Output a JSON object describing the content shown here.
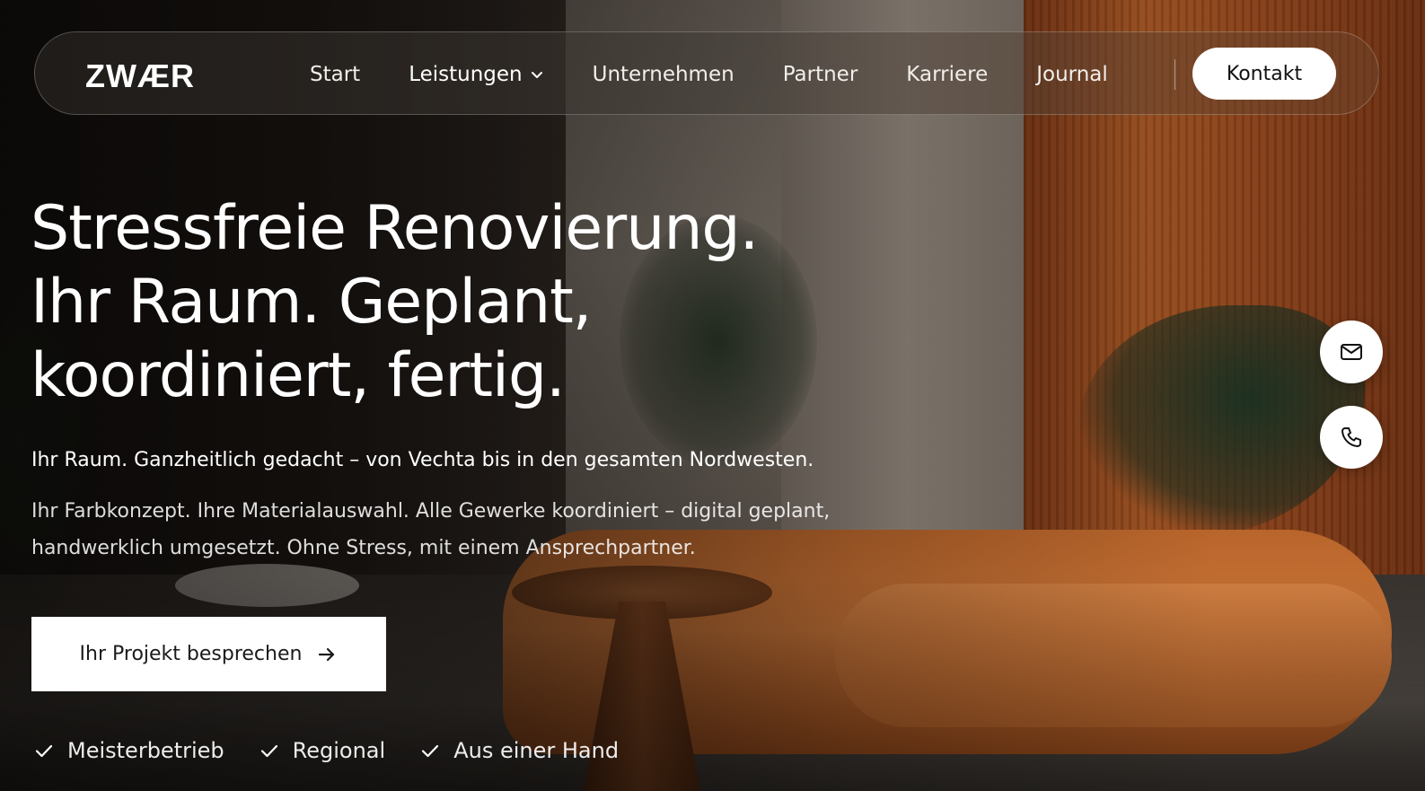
{
  "header": {
    "logo": "ZWÆR",
    "nav": [
      {
        "label": "Start"
      },
      {
        "label": "Leistungen",
        "has_dropdown": true
      },
      {
        "label": "Unternehmen"
      },
      {
        "label": "Partner"
      },
      {
        "label": "Karriere"
      },
      {
        "label": "Journal"
      }
    ],
    "contact_label": "Kontakt"
  },
  "hero": {
    "title_lines": [
      "Stressfreie Renovierung.",
      "Ihr Raum. Geplant,",
      "koordiniert, fertig."
    ],
    "subtitle": "Ihr Raum. Ganzheitlich gedacht – von Vechta bis in den gesamten Nordwesten.",
    "description_lines": [
      "Ihr Farbkonzept. Ihre Materialauswahl. Alle Gewerke koordiniert – digital geplant,",
      "handwerklich umgesetzt. Ohne Stress, mit einem Ansprechpartner."
    ],
    "cta_label": "Ihr Projekt besprechen",
    "features": [
      {
        "label": "Meisterbetrieb"
      },
      {
        "label": "Regional"
      },
      {
        "label": "Aus einer Hand"
      }
    ]
  },
  "side_actions": {
    "mail_icon": "mail-icon",
    "phone_icon": "phone-icon"
  },
  "colors": {
    "accent_button_bg": "#ffffff",
    "text_on_dark": "#ffffff",
    "wood_accent": "#a2521f"
  }
}
